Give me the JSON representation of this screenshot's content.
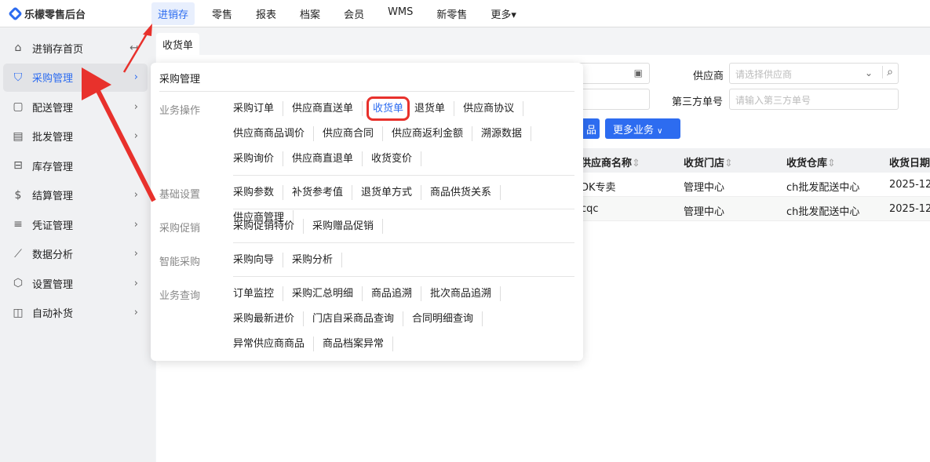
{
  "brand": "乐檬零售后台",
  "nav": [
    "进销存",
    "零售",
    "报表",
    "档案",
    "会员",
    "WMS",
    "新零售",
    "更多▾"
  ],
  "sidebar": [
    {
      "label": "进销存首页",
      "icon": "home-icon"
    },
    {
      "label": "采购管理",
      "icon": "cart-icon"
    },
    {
      "label": "配送管理",
      "icon": "box-icon"
    },
    {
      "label": "批发管理",
      "icon": "server-icon"
    },
    {
      "label": "库存管理",
      "icon": "inventory-icon"
    },
    {
      "label": "结算管理",
      "icon": "dollar-icon"
    },
    {
      "label": "凭证管理",
      "icon": "document-icon"
    },
    {
      "label": "数据分析",
      "icon": "chart-icon"
    },
    {
      "label": "设置管理",
      "icon": "settings-icon"
    },
    {
      "label": "自动补货",
      "icon": "replenish-icon"
    }
  ],
  "tab": "收货单",
  "form": {
    "supplier_label": "供应商",
    "supplier_placeholder": "请选择供应商",
    "third_label": "第三方单号",
    "third_placeholder": "请输入第三方单号"
  },
  "buttons": {
    "partial": "品",
    "more": "更多业务"
  },
  "table": {
    "headers": [
      "供应商名称",
      "收货门店",
      "收货仓库",
      "收货日期"
    ],
    "rows": [
      [
        "DK专卖",
        "管理中心",
        "ch批发配送中心",
        "2025-12"
      ],
      [
        "cqc",
        "管理中心",
        "ch批发配送中心",
        "2025-12"
      ]
    ]
  },
  "popover": {
    "title": "采购管理",
    "sections": [
      {
        "name": "业务操作",
        "items": [
          "采购订单",
          "供应商直送单",
          "收货单",
          "退货单",
          "供应商协议",
          "供应商商品调价",
          "供应商合同",
          "供应商返利金额",
          "溯源数据",
          "采购询价",
          "供应商直退单",
          "收货变价"
        ]
      },
      {
        "name": "基础设置",
        "items": [
          "采购参数",
          "补货参考值",
          "退货单方式",
          "商品供货关系",
          "供应商管理"
        ]
      },
      {
        "name": "采购促销",
        "items": [
          "采购促销特价",
          "采购赠品促销"
        ]
      },
      {
        "name": "智能采购",
        "items": [
          "采购向导",
          "采购分析"
        ]
      },
      {
        "name": "业务查询",
        "items": [
          "订单监控",
          "采购汇总明细",
          "商品追溯",
          "批次商品追溯",
          "采购最新进价",
          "门店自采商品查询",
          "合同明细查询",
          "异常供应商商品",
          "商品档案异常"
        ]
      }
    ],
    "highlighted": "收货单"
  },
  "colors": {
    "accent": "#2d6cf0",
    "annotation": "#e8312c"
  }
}
